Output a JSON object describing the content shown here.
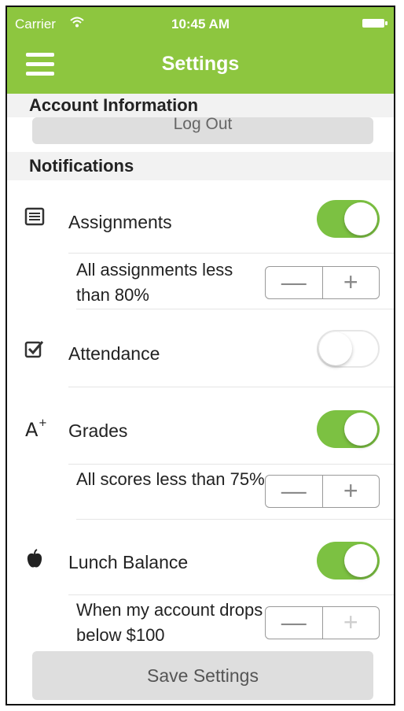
{
  "status_bar": {
    "carrier": "Carrier",
    "wifi_icon": "wifi-icon",
    "time": "10:45 AM",
    "battery_icon": "battery-icon"
  },
  "nav": {
    "title": "Settings",
    "menu_icon": "hamburger-icon"
  },
  "account": {
    "header": "Account Information",
    "logout_label": "Log Out"
  },
  "notifications": {
    "header": "Notifications",
    "items": [
      {
        "label": "Assignments",
        "icon": "list-icon",
        "enabled": true,
        "condition": "All assignments less than 80%"
      },
      {
        "label": "Attendance",
        "icon": "checkbox-icon",
        "enabled": false
      },
      {
        "label": "Grades",
        "icon": "a-plus-icon",
        "enabled": true,
        "condition": "All scores less than 75%"
      },
      {
        "label": "Lunch Balance",
        "icon": "apple-icon",
        "enabled": true,
        "condition": "When my account drops below $100"
      }
    ],
    "stepper": {
      "minus": "—",
      "plus": "+"
    }
  },
  "save_label": "Save Settings",
  "colors": {
    "accent": "#8dc63f",
    "toggle_on": "#7cc142"
  }
}
